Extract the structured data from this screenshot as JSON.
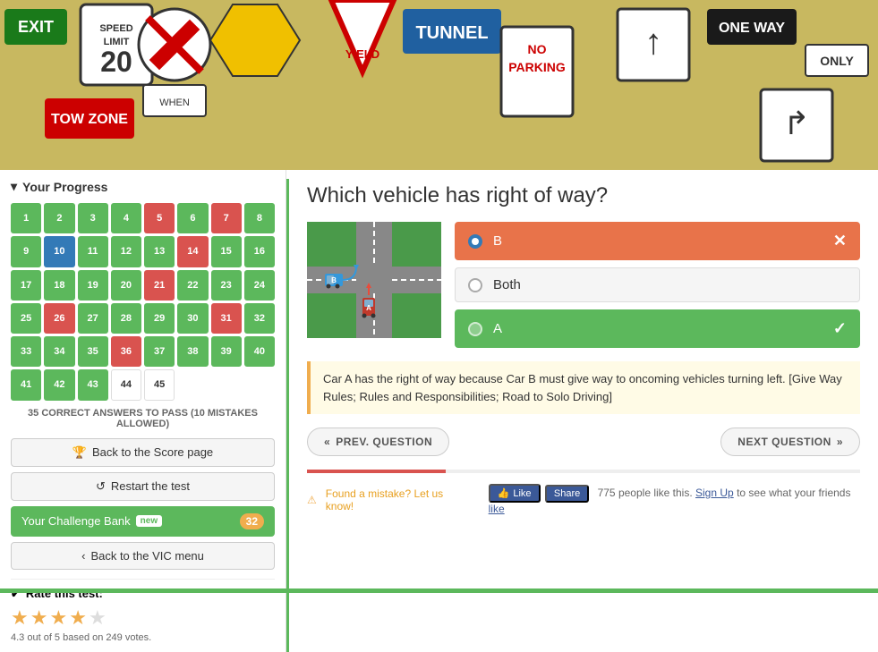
{
  "hero": {
    "alt": "Road signs background image"
  },
  "sidebar": {
    "progress_header": "Your Progress",
    "pass_text": "35 CORRECT ANSWERS TO PASS (10 MISTAKES ALLOWED)",
    "grid_cells": [
      {
        "num": 1,
        "state": "green"
      },
      {
        "num": 2,
        "state": "green"
      },
      {
        "num": 3,
        "state": "green"
      },
      {
        "num": 4,
        "state": "green"
      },
      {
        "num": 5,
        "state": "red"
      },
      {
        "num": 6,
        "state": "green"
      },
      {
        "num": 7,
        "state": "red"
      },
      {
        "num": 8,
        "state": "green"
      },
      {
        "num": 9,
        "state": "green"
      },
      {
        "num": 10,
        "state": "blue"
      },
      {
        "num": 11,
        "state": "green"
      },
      {
        "num": 12,
        "state": "green"
      },
      {
        "num": 13,
        "state": "green"
      },
      {
        "num": 14,
        "state": "red"
      },
      {
        "num": 15,
        "state": "green"
      },
      {
        "num": 16,
        "state": "green"
      },
      {
        "num": 17,
        "state": "green"
      },
      {
        "num": 18,
        "state": "green"
      },
      {
        "num": 19,
        "state": "green"
      },
      {
        "num": 20,
        "state": "green"
      },
      {
        "num": 21,
        "state": "red"
      },
      {
        "num": 22,
        "state": "green"
      },
      {
        "num": 23,
        "state": "green"
      },
      {
        "num": 24,
        "state": "green"
      },
      {
        "num": 25,
        "state": "green"
      },
      {
        "num": 26,
        "state": "red"
      },
      {
        "num": 27,
        "state": "green"
      },
      {
        "num": 28,
        "state": "green"
      },
      {
        "num": 29,
        "state": "green"
      },
      {
        "num": 30,
        "state": "green"
      },
      {
        "num": 31,
        "state": "red"
      },
      {
        "num": 32,
        "state": "green"
      },
      {
        "num": 33,
        "state": "green"
      },
      {
        "num": 34,
        "state": "green"
      },
      {
        "num": 35,
        "state": "green"
      },
      {
        "num": 36,
        "state": "red"
      },
      {
        "num": 37,
        "state": "green"
      },
      {
        "num": 38,
        "state": "green"
      },
      {
        "num": 39,
        "state": "green"
      },
      {
        "num": 40,
        "state": "green"
      },
      {
        "num": 41,
        "state": "green"
      },
      {
        "num": 42,
        "state": "green"
      },
      {
        "num": 43,
        "state": "green"
      },
      {
        "num": 44,
        "state": "white"
      },
      {
        "num": 45,
        "state": "white"
      }
    ],
    "btn_back_score": "Back to the Score page",
    "btn_restart": "Restart the test",
    "btn_challenge_bank": "Your Challenge Bank",
    "btn_challenge_bank_badge": "new",
    "btn_challenge_bank_count": "32",
    "btn_back_vic": "Back to the VIC menu",
    "rate_header": "Rate this test:",
    "rating_value": "4.3",
    "rating_max": "5",
    "rating_votes": "249",
    "rating_text": "4.3 out of 5 based on 249 votes.",
    "stars": [
      true,
      true,
      true,
      true,
      false
    ]
  },
  "question": {
    "text": "Which vehicle has right of way?",
    "options": [
      {
        "label": "B",
        "state": "wrong",
        "selected": true
      },
      {
        "label": "Both",
        "state": "neutral",
        "selected": false
      },
      {
        "label": "A",
        "state": "correct",
        "selected": false
      }
    ],
    "explanation": "Car A has the right of way because Car B must give way to oncoming vehicles turning left. [Give Way Rules; Rules and Responsibilities; Road to Solo Driving]",
    "nav": {
      "prev": "PREV. QUESTION",
      "next": "NEXT QUESTION"
    },
    "mistake_link": "Found a mistake? Let us know!",
    "fb_like_count": "775",
    "fb_like_text": "775 people like this.",
    "fb_signup_text": "Sign Up",
    "fb_signup_suffix": " to see what your friends ",
    "fb_like_suffix": "like"
  }
}
